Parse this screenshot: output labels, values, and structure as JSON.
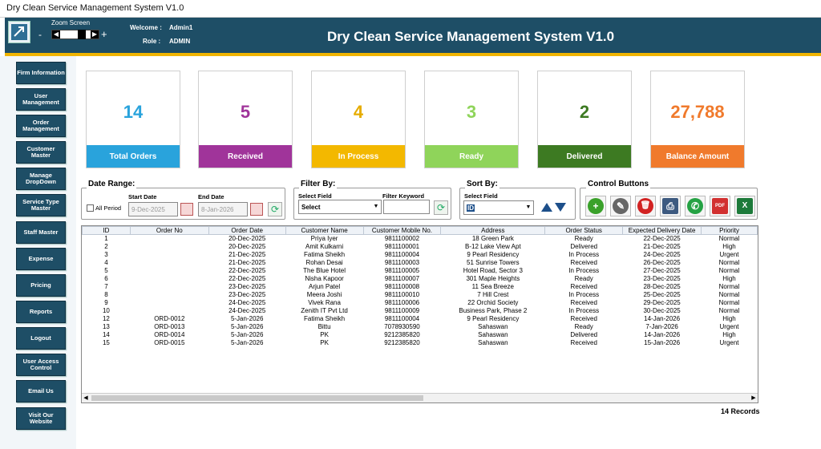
{
  "window": {
    "title": "Dry Clean Service Management System V1.0"
  },
  "header": {
    "zoom_label": "Zoom Screen",
    "zoom_minus": "-",
    "zoom_plus": "+",
    "welcome_label": "Welcome :",
    "welcome_value": "Admin1",
    "role_label": "Role :",
    "role_value": "ADMIN",
    "title": "Dry Clean Service Management System V1.0"
  },
  "sidebar": {
    "items": [
      {
        "label": "Firm Information"
      },
      {
        "label": "User Management"
      },
      {
        "label": "Order Management"
      },
      {
        "label": "Customer Master"
      },
      {
        "label": "Manage DropDown"
      },
      {
        "label": "Service Type Master"
      },
      {
        "label": "Staff Master"
      },
      {
        "label": "Expense"
      },
      {
        "label": "Pricing"
      },
      {
        "label": "Reports"
      },
      {
        "label": "Logout"
      },
      {
        "label": "User Access Control"
      },
      {
        "label": "Email Us"
      },
      {
        "label": "Visit Our Website"
      }
    ]
  },
  "cards": [
    {
      "value": "14",
      "label": "Total Orders",
      "color": "#29a3dc",
      "num_color": "#29a3dc"
    },
    {
      "value": "5",
      "label": "Received",
      "color": "#a0349a",
      "num_color": "#a0349a"
    },
    {
      "value": "4",
      "label": "In Process",
      "color": "#f3b800",
      "num_color": "#e6ac00"
    },
    {
      "value": "3",
      "label": "Ready",
      "color": "#8fd45a",
      "num_color": "#8fd45a"
    },
    {
      "value": "2",
      "label": "Delivered",
      "color": "#3d7a22",
      "num_color": "#3d7a22"
    },
    {
      "value": "27,788",
      "label": "Balance Amount",
      "color": "#f07a2c",
      "num_color": "#f07a2c"
    }
  ],
  "date_range": {
    "title": "Date Range:",
    "start_label": "Start Date",
    "end_label": "End Date",
    "all_period": "All Period",
    "start_value": "9-Dec-2025",
    "end_value": "8-Jan-2026"
  },
  "filter": {
    "title": "Filter By:",
    "field_label": "Select Field",
    "keyword_label": "Filter Keyword",
    "field_value": "Select",
    "keyword_value": ""
  },
  "sort": {
    "title": "Sort By:",
    "field_label": "Select Field",
    "field_value": "ID"
  },
  "controls": {
    "title": "Control Buttons",
    "buttons": [
      {
        "name": "add",
        "icon": "+",
        "color": "#3aa12a"
      },
      {
        "name": "edit",
        "icon": "✎",
        "color": "#555555"
      },
      {
        "name": "delete",
        "icon": "🗑",
        "color": "#d22222"
      },
      {
        "name": "print",
        "icon": "⎙",
        "color": "#3d5a80"
      },
      {
        "name": "whatsapp",
        "icon": "✆",
        "color": "#25a244"
      },
      {
        "name": "pdf",
        "icon": "PDF",
        "color": "#d23030"
      },
      {
        "name": "excel",
        "icon": "X",
        "color": "#1d7a3a"
      }
    ]
  },
  "grid": {
    "columns": [
      "ID",
      "Order No",
      "Order Date",
      "Customer Name",
      "Customer Mobile No.",
      "Address",
      "Order Status",
      "Expected Delivery Date",
      "Priority"
    ],
    "rows": [
      [
        "1",
        "",
        "20-Dec-2025",
        "Priya Iyer",
        "9811100002",
        "18 Green Park",
        "Ready",
        "22-Dec-2025",
        "Normal"
      ],
      [
        "2",
        "",
        "20-Dec-2025",
        "Amit Kulkarni",
        "9811100001",
        "B-12 Lake View Apt",
        "Delivered",
        "21-Dec-2025",
        "High"
      ],
      [
        "3",
        "",
        "21-Dec-2025",
        "Fatima Sheikh",
        "9811100004",
        "9 Pearl Residency",
        "In Process",
        "24-Dec-2025",
        "Urgent"
      ],
      [
        "4",
        "",
        "21-Dec-2025",
        "Rohan Desai",
        "9811100003",
        "51 Sunrise Towers",
        "Received",
        "26-Dec-2025",
        "Normal"
      ],
      [
        "5",
        "",
        "22-Dec-2025",
        "The Blue Hotel",
        "9811100005",
        "Hotel Road, Sector 3",
        "In Process",
        "27-Dec-2025",
        "Normal"
      ],
      [
        "6",
        "",
        "22-Dec-2025",
        "Nisha Kapoor",
        "9811100007",
        "301 Maple Heights",
        "Ready",
        "23-Dec-2025",
        "High"
      ],
      [
        "7",
        "",
        "23-Dec-2025",
        "Arjun Patel",
        "9811100008",
        "11 Sea Breeze",
        "Received",
        "28-Dec-2025",
        "Normal"
      ],
      [
        "8",
        "",
        "23-Dec-2025",
        "Meera Joshi",
        "9811100010",
        "7 Hill Crest",
        "In Process",
        "25-Dec-2025",
        "Normal"
      ],
      [
        "9",
        "",
        "24-Dec-2025",
        "Vivek Rana",
        "9811100006",
        "22 Orchid Society",
        "Received",
        "29-Dec-2025",
        "Normal"
      ],
      [
        "10",
        "",
        "24-Dec-2025",
        "Zenith IT Pvt Ltd",
        "9811100009",
        "Business Park, Phase 2",
        "In Process",
        "30-Dec-2025",
        "Normal"
      ],
      [
        "12",
        "ORD-0012",
        "5-Jan-2026",
        "Fatima Sheikh",
        "9811100004",
        "9 Pearl Residency",
        "Received",
        "14-Jan-2026",
        "High"
      ],
      [
        "13",
        "ORD-0013",
        "5-Jan-2026",
        "Bittu",
        "7078930590",
        "Sahaswan",
        "Ready",
        "7-Jan-2026",
        "Urgent"
      ],
      [
        "14",
        "ORD-0014",
        "5-Jan-2026",
        "PK",
        "9212385820",
        "Sahaswan",
        "Delivered",
        "14-Jan-2026",
        "High"
      ],
      [
        "15",
        "ORD-0015",
        "5-Jan-2026",
        "PK",
        "9212385820",
        "Sahaswan",
        "Received",
        "15-Jan-2026",
        "Urgent"
      ]
    ]
  },
  "footer": {
    "records": "14 Records"
  }
}
